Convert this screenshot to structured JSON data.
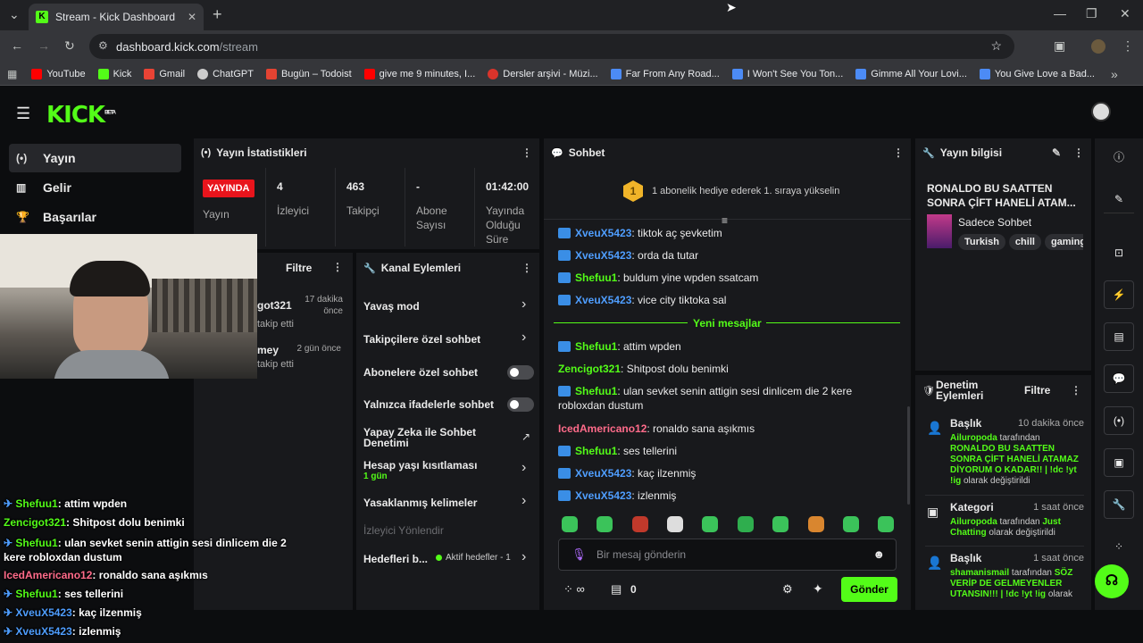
{
  "browser": {
    "tab_title": "Stream - Kick Dashboard",
    "url_host": "dashboard.kick.com",
    "url_path": "/stream",
    "bookmarks": [
      {
        "label": "YouTube",
        "color": "#ff0000"
      },
      {
        "label": "Kick",
        "color": "#53fc18"
      },
      {
        "label": "Gmail",
        "color": "#ea4335"
      },
      {
        "label": "ChatGPT",
        "color": "#cccccc"
      },
      {
        "label": "Bugün – Todoist",
        "color": "#e44332"
      },
      {
        "label": "give me 9 minutes, I...",
        "color": "#ff0000"
      },
      {
        "label": "Dersler arşivi - Müzi...",
        "color": "#d9342b"
      },
      {
        "label": "Far From Any Road...",
        "color": "#4c8bf5"
      },
      {
        "label": "I Won't See You Ton...",
        "color": "#4c8bf5"
      },
      {
        "label": "Gimme All Your Lovi...",
        "color": "#4c8bf5"
      },
      {
        "label": "You Give Love a Bad...",
        "color": "#4c8bf5"
      }
    ]
  },
  "logo": {
    "text": "KICK",
    "beta": "BETA"
  },
  "nav": [
    {
      "label": "Yayın",
      "icon": "broadcast-icon"
    },
    {
      "label": "Gelir",
      "icon": "chart-icon"
    },
    {
      "label": "Başarılar",
      "icon": "trophy-icon"
    }
  ],
  "stats": {
    "title": "Yayın İstatistikleri",
    "live_badge": "YAYINDA",
    "live_label": "Yayın",
    "viewers_value": "4",
    "viewers_label": "İzleyici",
    "followers_value": "463",
    "followers_label": "Takipçi",
    "subs_value": "-",
    "subs_label": "Abone Sayısı",
    "duration_value": "01:42:00",
    "duration_label": "Yayında Olduğu Süre"
  },
  "activity": {
    "filter": "Filtre",
    "items": [
      {
        "name": "got321",
        "action": "takip etti",
        "time": "17 dakika önce"
      },
      {
        "name": "mey",
        "action": "takip etti",
        "time": "2 gün önce"
      }
    ]
  },
  "channel_actions": {
    "title": "Kanal Eylemleri",
    "slow_mode": "Yavaş mod",
    "followers_chat": "Takipçilere özel sohbet",
    "subs_chat": "Abonelere özel sohbet",
    "emote_chat": "Yalnızca ifadelerle sohbet",
    "ai_moderation": "Yapay Zeka ile Sohbet Denetimi",
    "account_age": "Hesap yaşı kısıtlaması",
    "account_age_value": "1 gün",
    "banned_words": "Yasaklanmış kelimeler",
    "redirect": "İzleyici Yönlendir",
    "goals": "Hedefleri b...",
    "goals_status": "Aktif hedefler - 1"
  },
  "chat": {
    "title": "Sohbet",
    "gift_banner": "1 abonelik hediye ederek 1. sıraya yükselin",
    "gift_rank": "1",
    "new_messages": "Yeni mesajlar",
    "messages_before": [
      {
        "user": "XveuX5423",
        "text": ": tiktok aç şevketim",
        "color": "blue"
      },
      {
        "user": "XveuX5423",
        "text": ": orda da tutar",
        "color": "blue"
      },
      {
        "user": "Shefuu1",
        "text": ": buldum yine wpden ssatcam",
        "color": "green"
      },
      {
        "user": "XveuX5423",
        "text": ": vice city tiktoka sal",
        "color": "blue"
      }
    ],
    "messages_after": [
      {
        "user": "Shefuu1",
        "text": ": attim wpden",
        "color": "green"
      },
      {
        "user": "Zencigot321",
        "text": ": Shitpost dolu benimki",
        "color": "green"
      },
      {
        "user": "Shefuu1",
        "text": ": ulan sevket senin attigin sesi dinlicem die 2 kere robloxdan dustum",
        "color": "green"
      },
      {
        "user": "IcedAmericano12",
        "text": ": ronaldo sana aşıkmıs",
        "color": "pink"
      },
      {
        "user": "Shefuu1",
        "text": ": ses tellerini",
        "color": "green"
      },
      {
        "user": "XveuX5423",
        "text": ": kaç ilzenmiş",
        "color": "blue"
      },
      {
        "user": "XveuX5423",
        "text": ": izlenmiş",
        "color": "blue"
      }
    ],
    "input_placeholder": "Bir mesaj gönderin",
    "points": "0",
    "send": "Gönder"
  },
  "stream_info": {
    "title": "Yayın bilgisi",
    "stream_title": "RONALDO BU SAATTEN SONRA ÇİFT HANELİ ATAM...",
    "category": "Sadece Sohbet",
    "tags": [
      "Turkish",
      "chill",
      "gaming"
    ]
  },
  "moderation": {
    "title": "Denetim Eylemleri",
    "filter": "Filtre",
    "items": [
      {
        "type": "Başlık",
        "time": "10 dakika önce",
        "user": "Ailuropoda",
        "mid": " tarafından ",
        "value": "RONALDO BU SAATTEN SONRA ÇİFT HANELİ ATAMAZ DİYORUM O KADAR!! | !dc !yt !ig",
        "end": " olarak değiştirildi"
      },
      {
        "type": "Kategori",
        "time": "1 saat önce",
        "user": "Ailuropoda",
        "mid": " tarafından ",
        "value": "Just Chatting",
        "end": " olarak değiştirildi"
      },
      {
        "type": "Başlık",
        "time": "1 saat önce",
        "user": "shamanismail",
        "mid": " tarafından ",
        "value": "SÖZ VERİP DE GELMEYENLER UTANSIN!!! | !dc !yt !ig",
        "end": " olarak"
      }
    ]
  },
  "overlay_chat": [
    {
      "user": "Shefuu1",
      "text": ": attim wpden",
      "color": "green",
      "badge": true
    },
    {
      "user": "Zencigot321",
      "text": ": Shitpost dolu benimki",
      "color": "green",
      "badge": false
    },
    {
      "user": "Shefuu1",
      "text": ": ulan sevket senin attigin sesi dinlicem die 2 kere robloxdan dustum",
      "color": "green",
      "badge": true
    },
    {
      "user": "IcedAmericano12",
      "text": ": ronaldo sana aşıkmıs",
      "color": "pink",
      "badge": false
    },
    {
      "user": "Shefuu1",
      "text": ": ses tellerini",
      "color": "green",
      "badge": true
    },
    {
      "user": "XveuX5423",
      "text": ": kaç ilzenmiş",
      "color": "blue",
      "badge": true
    },
    {
      "user": "XveuX5423",
      "text": ": izlenmiş",
      "color": "blue",
      "badge": true
    }
  ]
}
